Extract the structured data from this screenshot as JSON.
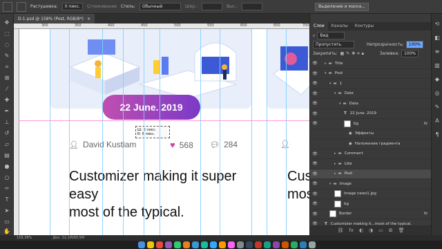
{
  "options_bar": {
    "feather_label": "Растушевка:",
    "feather_value": "0 пикс.",
    "antialias_label": "Сглаживание",
    "style_label": "Стиль:",
    "style_value": "Обычный",
    "width_label": "Шир.:",
    "height_label": "Выс.:",
    "select_mask_button": "Выделение и маска..."
  },
  "document_tab": {
    "title": "D-1.psd @ 158% (Post, RGB/8*)",
    "close": "×"
  },
  "ruler": {
    "marks": [
      "300",
      "350",
      "400",
      "450",
      "500",
      "550",
      "600",
      "650",
      "700"
    ]
  },
  "canvas": {
    "date": "22 June. 2019",
    "author": "David Kustiam",
    "likes": "568",
    "comments": "284",
    "headline_line1": "Customizer making it super easy",
    "headline_line2": "most of the typical.",
    "right_headline_line1": "Cus",
    "right_headline_line2": "mos",
    "measure_tooltip_line1": "Ш: 6 пикс.",
    "measure_tooltip_line2": "В: 6 пикс."
  },
  "layers_panel": {
    "tabs": [
      "Слои",
      "Каналы",
      "Контуры"
    ],
    "active_tab": "Слои",
    "filter_label": "Вид",
    "blend_mode": "Пропустить",
    "opacity_label": "Непрозрачность:",
    "opacity_value": "100%",
    "lock_label": "Закрепить:",
    "fill_label": "Заливка:",
    "fill_value": "100%",
    "layers": [
      {
        "name": "Title",
        "indent": 1,
        "type": "folder",
        "selected": false
      },
      {
        "name": "Post",
        "indent": 1,
        "type": "folder-open",
        "selected": false
      },
      {
        "name": "1",
        "indent": 2,
        "type": "folder-open",
        "selected": false
      },
      {
        "name": "Date",
        "indent": 3,
        "type": "folder-open",
        "selected": false
      },
      {
        "name": "Data",
        "indent": 4,
        "type": "folder-open",
        "selected": false
      },
      {
        "name": "22 June. 2019",
        "indent": 5,
        "type": "text",
        "selected": false
      },
      {
        "name": "bg",
        "indent": 5,
        "type": "shape",
        "selected": false,
        "fx": "fx"
      },
      {
        "name": "Эффекты",
        "indent": 6,
        "type": "effect",
        "selected": false
      },
      {
        "name": "Наложение градиента",
        "indent": 6,
        "type": "effect",
        "selected": false
      },
      {
        "name": "Comment",
        "indent": 3,
        "type": "folder",
        "selected": false
      },
      {
        "name": "Like",
        "indent": 3,
        "type": "folder",
        "selected": false
      },
      {
        "name": "Post",
        "indent": 3,
        "type": "folder",
        "selected": true
      },
      {
        "name": "Image",
        "indent": 2,
        "type": "folder-open",
        "selected": false
      },
      {
        "name": "Image news1.jpg",
        "indent": 3,
        "type": "image",
        "selected": false
      },
      {
        "name": "bg",
        "indent": 3,
        "type": "shape",
        "selected": false
      },
      {
        "name": "Border",
        "indent": 2,
        "type": "shape",
        "selected": false,
        "fx": "fx"
      },
      {
        "name": "Customizer making it...most of the typical.",
        "indent": 1,
        "type": "text",
        "selected": false
      }
    ]
  },
  "status_bar": {
    "zoom": "158,38%",
    "doc": "Док: 22,1M/90,5M"
  },
  "colors": {
    "accent_gradient_start": "#c04fb0",
    "accent_gradient_end": "#7a3ac7",
    "like_heart": "#c6479e",
    "guide": "#7fd0ff"
  }
}
